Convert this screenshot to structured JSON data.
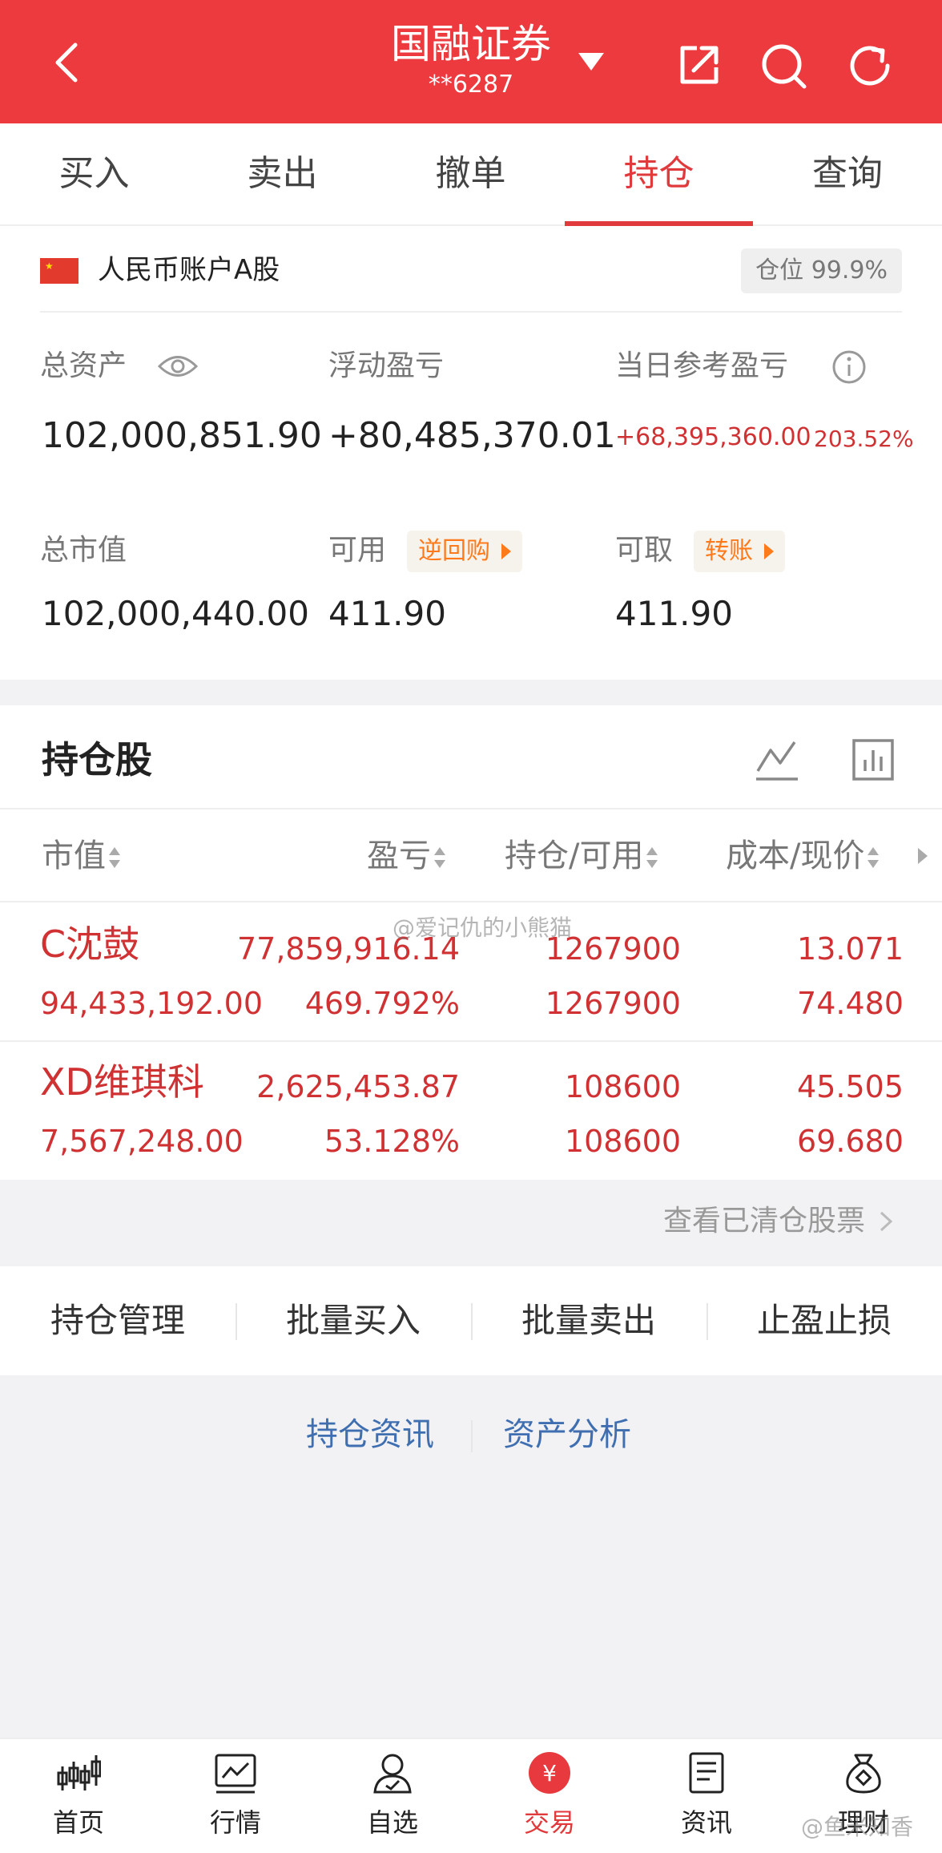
{
  "header": {
    "title": "国融证券",
    "account": "**6287",
    "icons": [
      "back-icon",
      "caret-down-icon",
      "share-icon",
      "search-icon",
      "refresh-icon"
    ]
  },
  "tabs": [
    {
      "label": "买入"
    },
    {
      "label": "卖出"
    },
    {
      "label": "撤单"
    },
    {
      "label": "持仓",
      "active": true
    },
    {
      "label": "查询"
    }
  ],
  "account": {
    "name": "人民币账户A股",
    "position_label": "仓位 99.9%"
  },
  "metrics": {
    "total_assets_label": "总资产",
    "total_assets": "102,000,851.90",
    "floating_pnl_label": "浮动盈亏",
    "floating_pnl": "+80,485,370.01",
    "daily_pnl_label": "当日参考盈亏",
    "daily_pnl": "+68,395,360.00",
    "daily_pnl_pct": "203.52%",
    "market_value_label": "总市值",
    "market_value": "102,000,440.00",
    "available_label": "可用",
    "repo_tag": "逆回购",
    "available": "411.90",
    "withdrawable_label": "可取",
    "transfer_tag": "转账",
    "withdrawable": "411.90"
  },
  "holdings": {
    "title": "持仓股",
    "columns": [
      "市值",
      "盈亏",
      "持仓/可用",
      "成本/现价"
    ],
    "rows": [
      {
        "name": "C沈鼓",
        "market_value": "94,433,192.00",
        "pnl": "77,859,916.14",
        "pnl_pct": "469.792%",
        "position": "1267900",
        "available": "1267900",
        "cost": "13.071",
        "price": "74.480"
      },
      {
        "name": "XD维琪科",
        "market_value": "7,567,248.00",
        "pnl": "2,625,453.87",
        "pnl_pct": "53.128%",
        "position": "108600",
        "available": "108600",
        "cost": "45.505",
        "price": "69.680"
      }
    ],
    "view_cleared": "查看已清仓股票"
  },
  "actions": [
    "持仓管理",
    "批量买入",
    "批量卖出",
    "止盈止损"
  ],
  "links": [
    "持仓资讯",
    "资产分析"
  ],
  "nav": [
    {
      "label": "首页",
      "icon": "home-candlestick-icon"
    },
    {
      "label": "行情",
      "icon": "market-chart-icon"
    },
    {
      "label": "自选",
      "icon": "watchlist-user-icon"
    },
    {
      "label": "交易",
      "icon": "trade-yuan-icon",
      "active": true
    },
    {
      "label": "资讯",
      "icon": "news-document-icon"
    },
    {
      "label": "理财",
      "icon": "wealth-bag-icon"
    }
  ],
  "watermarks": [
    "@爱记仇的小熊猫",
    "@鱼米知香"
  ],
  "colors": {
    "brand_red": "#ec3a3f",
    "profit_red": "#d03234",
    "tag_orange": "#ff7a1a",
    "link_blue": "#3f6fb0"
  }
}
